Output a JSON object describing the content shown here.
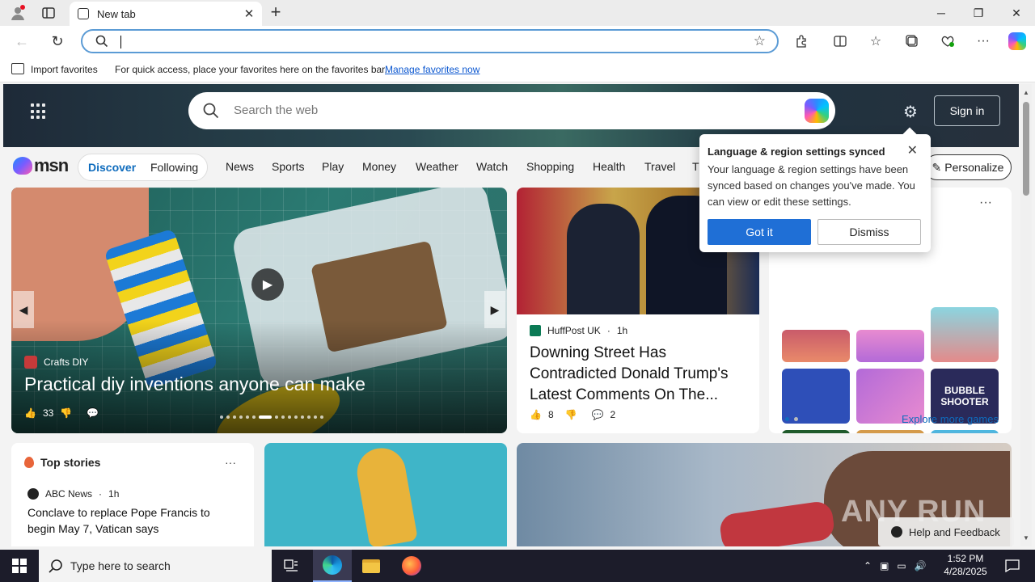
{
  "browser": {
    "tab_title": "New tab",
    "address_value": "",
    "favorites_bar": {
      "import_label": "Import favorites",
      "message": "For quick access, place your favorites here on the favorites bar.",
      "manage_link": "Manage favorites now"
    }
  },
  "msn": {
    "search_placeholder": "Search the web",
    "sign_in": "Sign in",
    "logo_text": "msn",
    "feed_tabs": [
      "Discover",
      "Following"
    ],
    "nav": [
      "News",
      "Sports",
      "Play",
      "Money",
      "Weather",
      "Watch",
      "Shopping",
      "Health",
      "Travel",
      "T"
    ],
    "personalize": "Personalize"
  },
  "popup": {
    "title": "Language & region settings synced",
    "body": "Your language & region settings have been synced based on changes you've made. You can view or edit these settings.",
    "got_it": "Got it",
    "dismiss": "Dismiss"
  },
  "hero_card": {
    "source": "Crafts DIY",
    "headline": "Practical diy inventions anyone can make",
    "likes": "33"
  },
  "news_card": {
    "source": "HuffPost UK",
    "time": "1h",
    "headline": "Downing Street Has Contradicted Donald Trump's Latest Comments On The...",
    "likes": "8",
    "comments": "2"
  },
  "games_card": {
    "explore_label": "Explore more games",
    "tiles": [
      "game-tile-1",
      "game-tile-2",
      "game-tile-3",
      "game-tile-4",
      "game-tile-5",
      "game-tile-bubble-shooter",
      "game-tile-mahjong",
      "game-tile-screw-puzzle",
      "game-tile-8"
    ],
    "bubble_label": "BUBBLE SHOOTER"
  },
  "top_stories": {
    "title": "Top stories",
    "source": "ABC News",
    "time": "1h",
    "headline": "Conclave to replace Pope Francis to begin May 7, Vatican says"
  },
  "help": {
    "label": "Help and Feedback"
  },
  "watermark": "ANY RUN",
  "taskbar": {
    "search_placeholder": "Type here to search",
    "time": "1:52 PM",
    "date": "4/28/2025"
  },
  "colors": {
    "accent": "#0f6cbd",
    "got_it_button": "#1f6fd6",
    "taskbar": "#1c1c2a"
  }
}
